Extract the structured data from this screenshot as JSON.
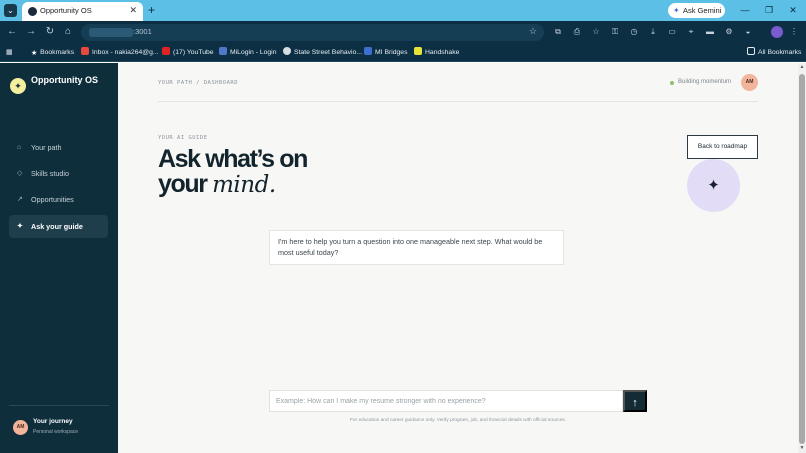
{
  "browser": {
    "tab_title": "Opportunity OS",
    "tab_close": "✕",
    "new_tab": "+",
    "ask_gemini": "Ask Gemini",
    "url": ":3001",
    "window_controls": {
      "minimize": "—",
      "restore": "❐",
      "close": "✕"
    },
    "bookmarks": [
      {
        "label": "Bookmarks",
        "icon": "star-icon"
      },
      {
        "label": "Inbox - nakia264@g...",
        "icon": "gmail-icon"
      },
      {
        "label": "(17) YouTube",
        "icon": "youtube-icon"
      },
      {
        "label": "MiLogin - Login",
        "icon": "page-icon"
      },
      {
        "label": "State Street Behavio...",
        "icon": "globe-icon"
      },
      {
        "label": "MI Bridges",
        "icon": "mi-bridges-icon"
      },
      {
        "label": "Handshake",
        "icon": "handshake-icon"
      }
    ],
    "all_bookmarks": "All Bookmarks"
  },
  "sidebar": {
    "logo_mark": "✦",
    "brand": "Opportunity OS",
    "items": [
      {
        "label": "Your path",
        "icon": "⌂",
        "active": false
      },
      {
        "label": "Skills studio",
        "icon": "◇",
        "active": false
      },
      {
        "label": "Opportunities",
        "icon": "↗",
        "active": false
      },
      {
        "label": "Ask your guide",
        "icon": "✦",
        "active": true
      }
    ],
    "user": {
      "initials": "AM",
      "title": "Your journey",
      "subtitle": "Personal workspace"
    }
  },
  "header": {
    "breadcrumb": "YOUR PATH   /   DASHBOARD",
    "status": "Building momentum",
    "avatar_initials": "AM"
  },
  "guide": {
    "eyebrow": "YOUR AI GUIDE",
    "heading_line1": "Ask what’s on",
    "heading_line2_plain": "your ",
    "heading_line2_italic": "mind.",
    "back_button": "Back to roadmap",
    "orb_icon": "✦",
    "message": "I'm here to help you turn a question into one manageable next step. What would be most useful today?",
    "input_placeholder": "Example: How can I make my resume stronger with no experience?",
    "send_icon": "↑",
    "disclaimer": "For education and career guidance only. Verify program, job, and financial details with official sources."
  },
  "colors": {
    "sidebar_bg": "#0f2e3c",
    "accent_yellow": "#f4ef9e",
    "orb_lavender": "#e2dcf6",
    "status_green": "#8ac06a",
    "avatar_peach": "#f2b59b"
  }
}
